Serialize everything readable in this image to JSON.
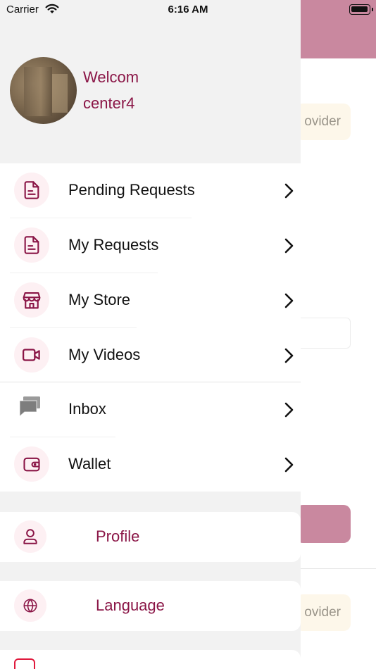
{
  "status_bar": {
    "carrier": "Carrier",
    "time": "6:16 AM"
  },
  "background": {
    "chip_1": "ovider",
    "chip_2": "ovider"
  },
  "drawer": {
    "welcome": "Welcom",
    "username": "center4",
    "menu": [
      {
        "label": "Pending Requests",
        "icon": "document-icon"
      },
      {
        "label": "My Requests",
        "icon": "document-icon"
      },
      {
        "label": "My Store",
        "icon": "store-icon"
      },
      {
        "label": "My Videos",
        "icon": "video-icon"
      },
      {
        "label": "Inbox",
        "icon": "chat-icon"
      },
      {
        "label": "Wallet",
        "icon": "wallet-icon"
      }
    ],
    "cards": [
      {
        "label": "Profile",
        "icon": "user-icon"
      },
      {
        "label": "Language",
        "icon": "globe-icon"
      }
    ]
  },
  "colors": {
    "accent": "#8a1546",
    "header_bg": "#c9889f",
    "icon_bg": "#fdf0f3",
    "drawer_bg": "#f2f2f2"
  }
}
